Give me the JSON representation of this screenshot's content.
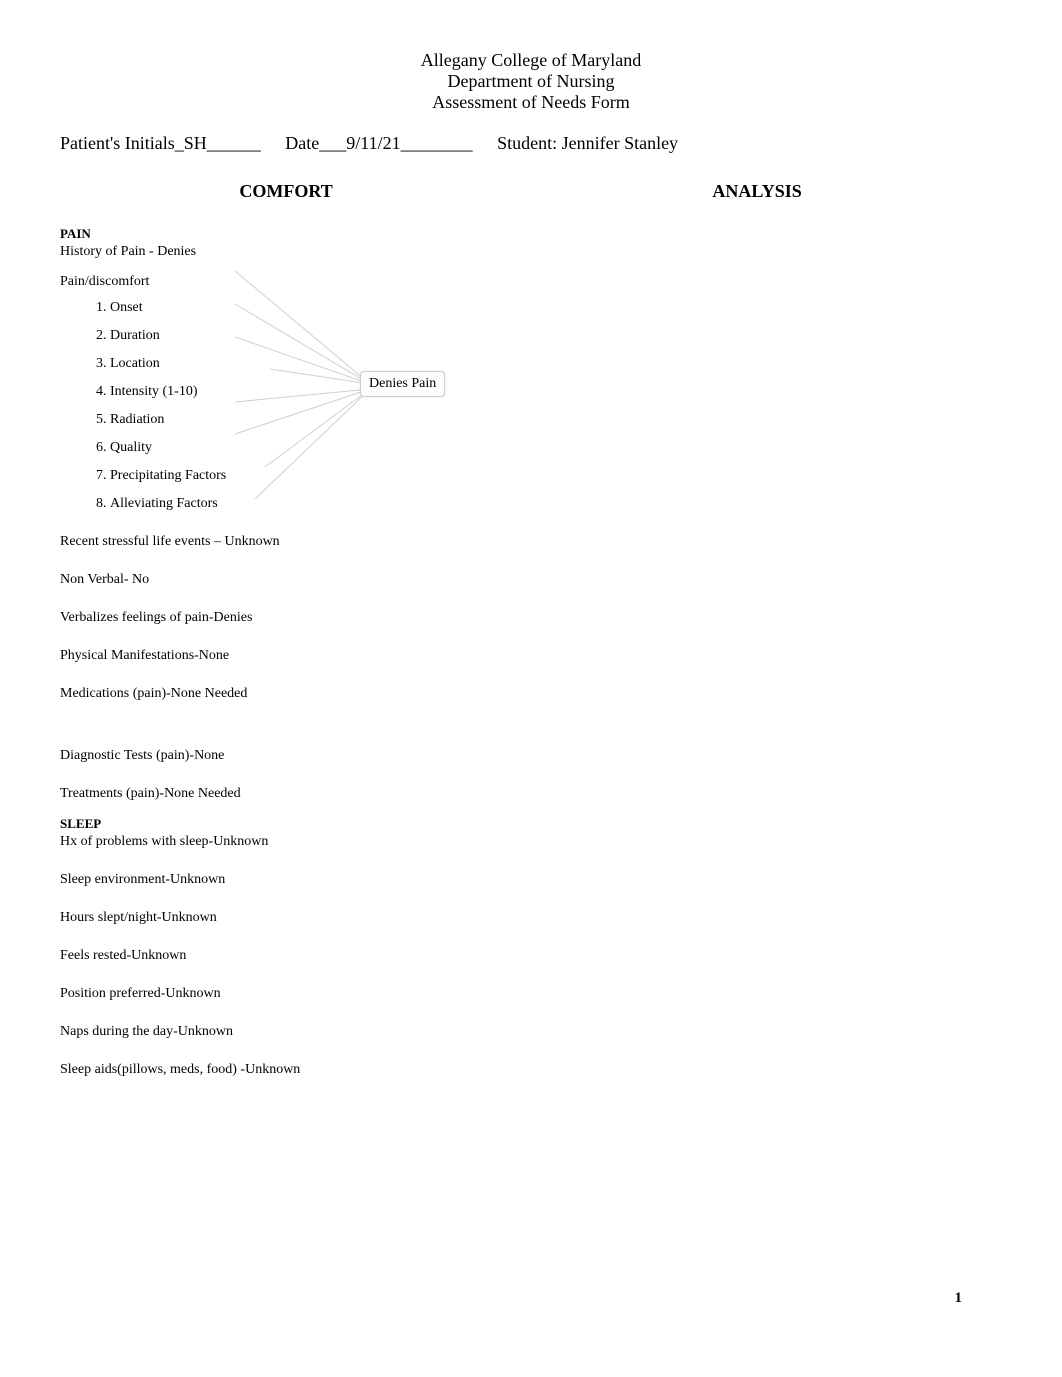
{
  "header": {
    "line1": "Allegany College of Maryland",
    "line2": "Department of Nursing",
    "line3": "Assessment of Needs Form"
  },
  "info": {
    "initials_label": "Patient's Initials_",
    "initials_value": "SH______",
    "date_label": "Date___",
    "date_value": "9/11/21________",
    "student_label": "Student: ",
    "student_value": "Jennifer Stanley"
  },
  "columns": {
    "left_header": "COMFORT",
    "right_header": "ANALYSIS"
  },
  "comfort": {
    "pain_title": "PAIN",
    "history_pain": "History of Pain - Denies",
    "pain_discomfort_label": "Pain/discomfort",
    "items": [
      "Onset",
      "Duration",
      "Location",
      "Intensity (1-10)",
      "Radiation",
      "Quality",
      "Precipitating Factors",
      "Alleviating Factors"
    ],
    "callout": "Denies Pain",
    "recent_stress": "Recent stressful life events – Unknown",
    "nonverbal": "Non Verbal- No",
    "verbalizes": "Verbalizes feelings of pain-Denies",
    "physical": "Physical Manifestations-None",
    "medications": "Medications (pain)-None Needed",
    "diagnostic": "Diagnostic Tests (pain)-None",
    "treatments": "Treatments (pain)-None Needed",
    "sleep_title": "SLEEP",
    "hx_sleep": "Hx of problems with sleep-Unknown",
    "sleep_env": "Sleep environment-Unknown",
    "hours_slept": "Hours slept/night-Unknown",
    "feels_rested": "Feels rested-Unknown",
    "position": "Position preferred-Unknown",
    "naps": "Naps during the day-Unknown",
    "sleep_aids": "Sleep aids(pillows, meds, food) -Unknown"
  },
  "page_number": "1"
}
